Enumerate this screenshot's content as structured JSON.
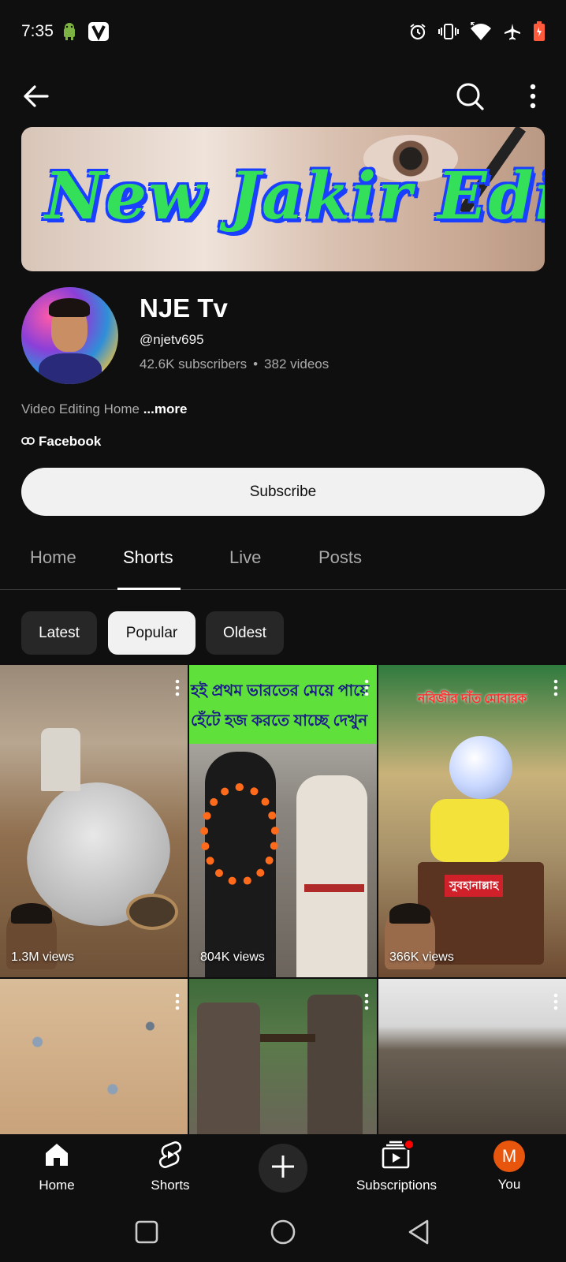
{
  "status_bar": {
    "time": "7:35",
    "left_icons": [
      "android-icon",
      "v-app-icon"
    ],
    "right_icons": [
      "alarm-icon",
      "vibrate-icon",
      "wifi-icon",
      "airplane-icon",
      "battery-icon"
    ]
  },
  "app_bar": {
    "back_icon": "back-arrow-icon",
    "search_icon": "search-icon",
    "more_icon": "more-vert-icon"
  },
  "banner": {
    "text": "New Jakir Editing Tv"
  },
  "channel": {
    "name": "NJE Tv",
    "handle": "@njetv695",
    "subscribers": "42.6K subscribers",
    "separator": "•",
    "videos": "382 videos",
    "description": "Video Editing Home",
    "more_label": "...more",
    "link_label": "Facebook"
  },
  "subscribe": {
    "label": "Subscribe"
  },
  "tabs": [
    {
      "label": "Home",
      "active": false
    },
    {
      "label": "Shorts",
      "active": true
    },
    {
      "label": "Live",
      "active": false
    },
    {
      "label": "Posts",
      "active": false
    }
  ],
  "chips": [
    {
      "label": "Latest",
      "active": false
    },
    {
      "label": "Popular",
      "active": true
    },
    {
      "label": "Oldest",
      "active": false
    }
  ],
  "shorts": [
    {
      "views": "1.3M views",
      "overlay_text": ""
    },
    {
      "views": "804K views",
      "overlay_text": "হই প্রথম ভারতের মেয়ে পায়ে হেঁটে হজ করতে যাচ্ছে দেখুন"
    },
    {
      "views": "366K views",
      "overlay_text": "নবিজীর দাঁত মোবারক",
      "caption": "সুবহানাল্লাহ"
    },
    {
      "views": "",
      "overlay_text": ""
    },
    {
      "views": "",
      "overlay_text": ""
    },
    {
      "views": "",
      "overlay_text": ""
    }
  ],
  "bottom_nav": {
    "home": "Home",
    "shorts": "Shorts",
    "create_icon": "plus-icon",
    "subscriptions": "Subscriptions",
    "you": "You",
    "you_initial": "M"
  },
  "colors": {
    "background": "#0f0f0f",
    "chip_bg": "#272727",
    "active_chip_bg": "#f1f1f1",
    "notification_dot": "#ff0000",
    "you_avatar": "#e8560e"
  }
}
